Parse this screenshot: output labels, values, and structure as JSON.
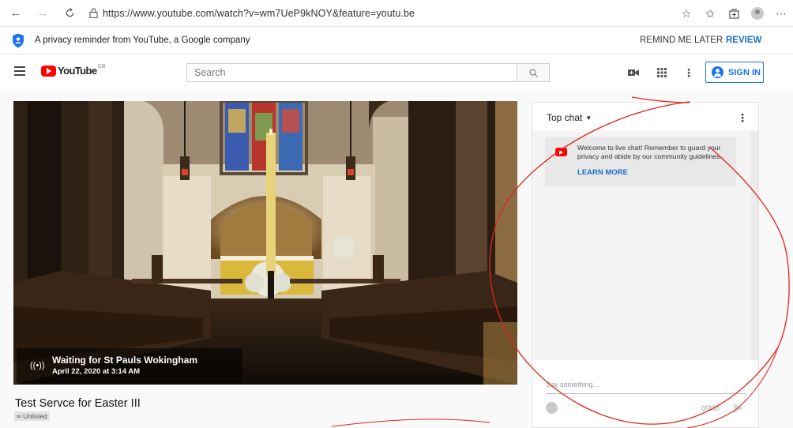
{
  "browser": {
    "url": "https://www.youtube.com/watch?v=wm7UeP9kNOY&feature=youtu.be"
  },
  "privacy_banner": {
    "text": "A privacy reminder from YouTube, a Google company",
    "remind_label": "REMIND ME LATER",
    "review_label": "REVIEW"
  },
  "header": {
    "logo_text": "YouTube",
    "logo_region": "GB",
    "search_placeholder": "Search",
    "sign_in_label": "SIGN IN"
  },
  "video": {
    "live_title": "Waiting for St Pauls Wokingham",
    "live_time": "April 22, 2020 at 3:14 AM",
    "title": "Test Servce for Easter III",
    "visibility": "Unlisted"
  },
  "chat": {
    "mode": "Top chat",
    "welcome_text": "Welcome to live chat! Remember to guard your privacy and abide by our community guidelines.",
    "learn_more": "LEARN MORE",
    "input_placeholder": "Say something...",
    "char_count": "0/200"
  },
  "colors": {
    "accent_blue": "#1a73e8",
    "youtube_red": "#ff0000",
    "annotation_red": "#e0261c"
  }
}
